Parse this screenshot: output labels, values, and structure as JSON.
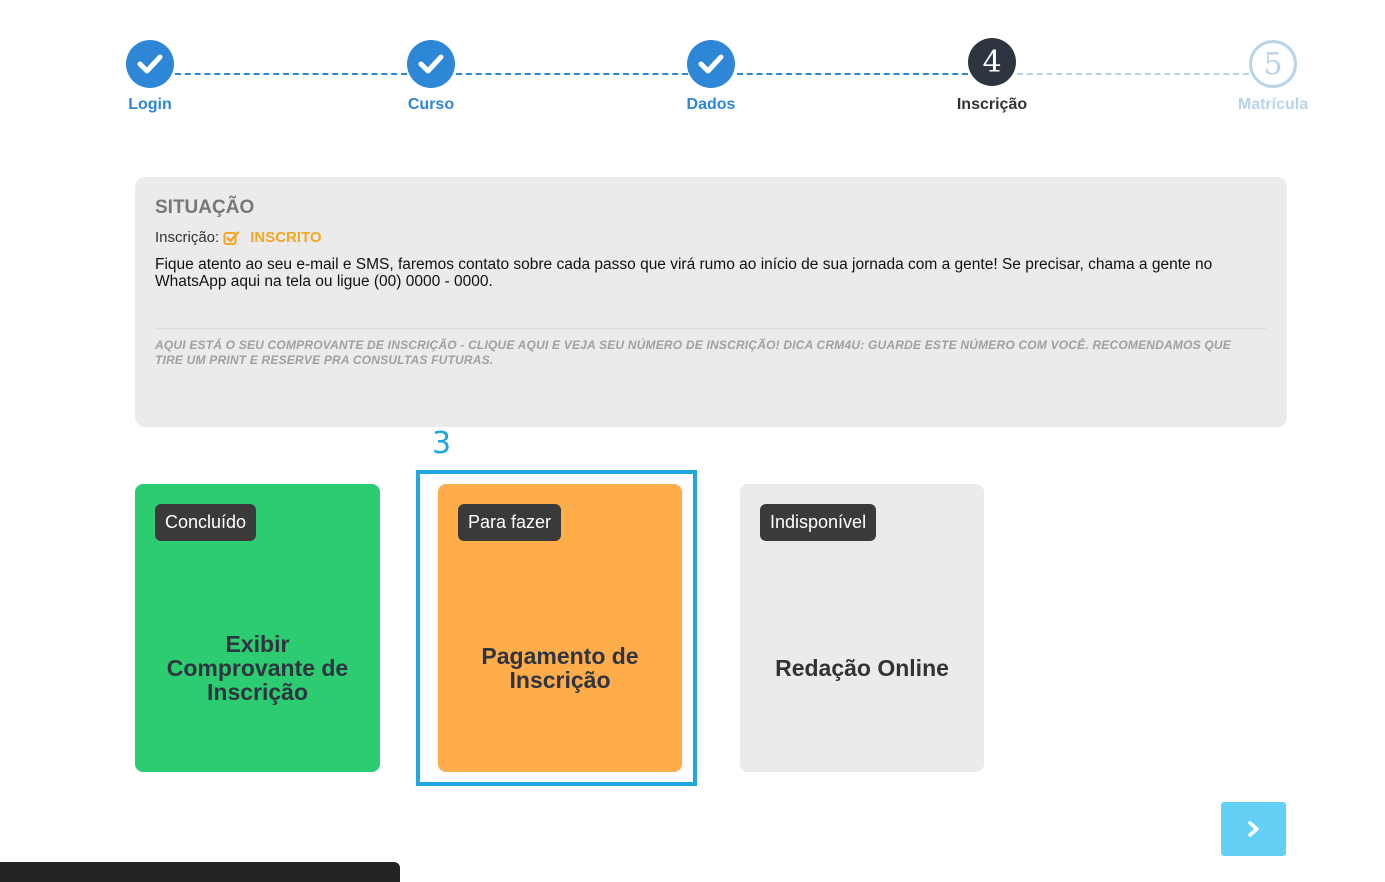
{
  "stepper": {
    "steps": [
      {
        "label": "Login",
        "state": "done"
      },
      {
        "label": "Curso",
        "state": "done"
      },
      {
        "label": "Dados",
        "state": "done"
      },
      {
        "label": "Inscrição",
        "state": "current",
        "number": "4"
      },
      {
        "label": "Matrícula",
        "state": "pending",
        "number": "5"
      }
    ]
  },
  "situation": {
    "title": "SITUAÇÃO",
    "registration_label": "Inscrição:",
    "registration_status": "INSCRITO",
    "message": "Fique atento ao seu e-mail e SMS, faremos contato sobre cada passo que virá rumo ao início de sua jornada com a gente! Se precisar, chama a gente no WhatsApp aqui na tela ou ligue (00) 0000 - 0000.",
    "note": "AQUI ESTÁ O SEU COMPROVANTE DE INSCRIÇÃO - CLIQUE AQUI E VEJA SEU NÚMERO DE INSCRIÇÃO! DICA CRM4U: GUARDE ESTE NÚMERO COM VOCÊ. RECOMENDAMOS QUE TIRE UM PRINT E RESERVE PRA CONSULTAS FUTURAS."
  },
  "cards": [
    {
      "badge": "Concluído",
      "title": "Exibir Comprovante de Inscrição",
      "color": "#2ecc71"
    },
    {
      "badge": "Para fazer",
      "title": "Pagamento de Inscrição",
      "color": "#ffad4a"
    },
    {
      "badge": "Indisponível",
      "title": "Redação Online",
      "color": "#ebebeb"
    }
  ],
  "highlight": {
    "number": "3",
    "color": "#1fa6dc"
  },
  "colors": {
    "primary": "#2e86d6",
    "status_orange": "#f5a623",
    "next_button": "#64d0f5"
  },
  "icons": {
    "completed_step": "check-icon",
    "status": "checkbox-icon",
    "next": "chevron-right-icon"
  }
}
